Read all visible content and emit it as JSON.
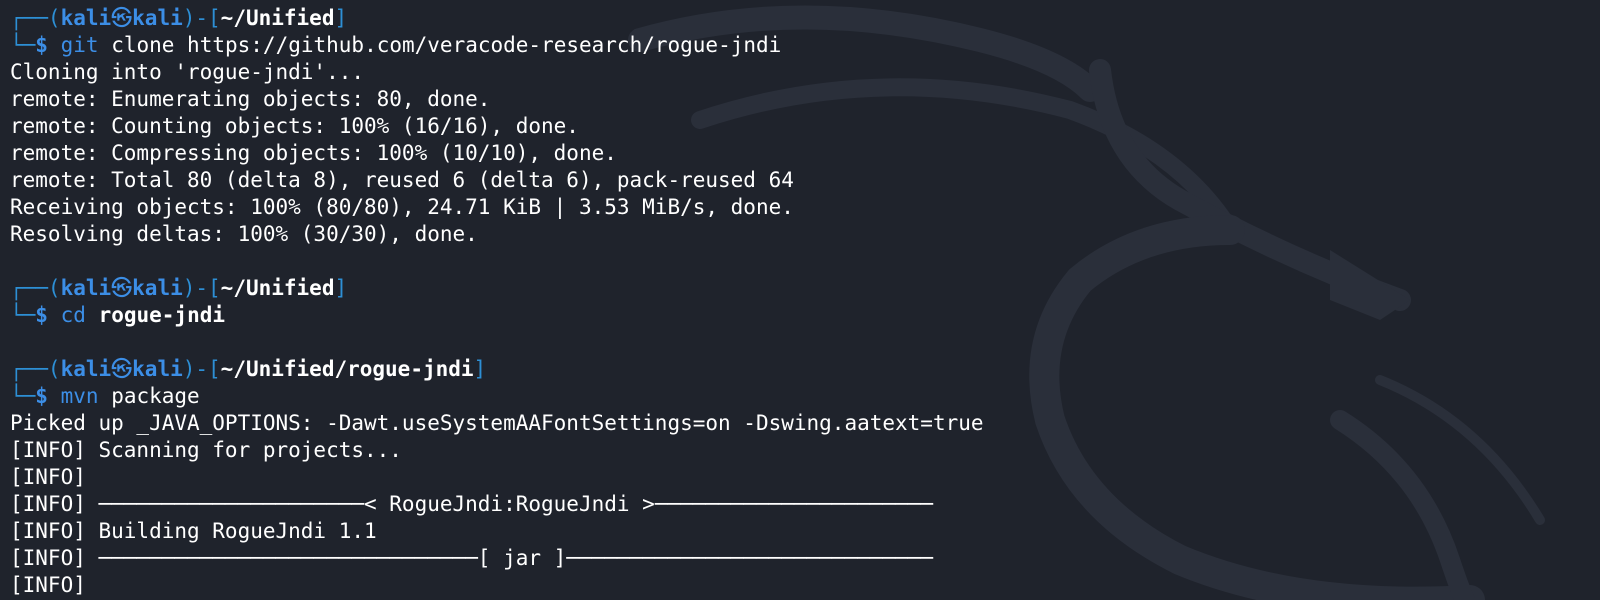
{
  "colors": {
    "background": "#1f232c",
    "prompt_accent": "#3c8ee6",
    "text": "#ffffff"
  },
  "icons": {
    "background_logo": "kali-dragon-icon",
    "user_separator": "kali-k-icon"
  },
  "prompt": {
    "user": "kali",
    "sep_glyph": "㉿",
    "host": "kali",
    "dollar": "$"
  },
  "blocks": [
    {
      "path": "~/Unified",
      "command": "git",
      "args": "clone https://github.com/veracode-research/rogue-jndi",
      "args_bold": false,
      "output": [
        "Cloning into 'rogue-jndi'...",
        "remote: Enumerating objects: 80, done.",
        "remote: Counting objects: 100% (16/16), done.",
        "remote: Compressing objects: 100% (10/10), done.",
        "remote: Total 80 (delta 8), reused 6 (delta 6), pack-reused 64",
        "Receiving objects: 100% (80/80), 24.71 KiB | 3.53 MiB/s, done.",
        "Resolving deltas: 100% (30/30), done."
      ]
    },
    {
      "path": "~/Unified",
      "command": "cd",
      "args": "rogue-jndi",
      "args_bold": true,
      "output": []
    },
    {
      "path": "~/Unified/rogue-jndi",
      "command": "mvn",
      "args": "package",
      "args_bold": false,
      "output": [
        "Picked up _JAVA_OPTIONS: -Dawt.useSystemAAFontSettings=on -Dswing.aatext=true",
        "[INFO] Scanning for projects...",
        "[INFO]",
        "[INFO] ─────────────────────< RogueJndi:RogueJndi >──────────────────────",
        "[INFO] Building RogueJndi 1.1",
        "[INFO] ──────────────────────────────[ jar ]─────────────────────────────",
        "[INFO]"
      ]
    }
  ]
}
